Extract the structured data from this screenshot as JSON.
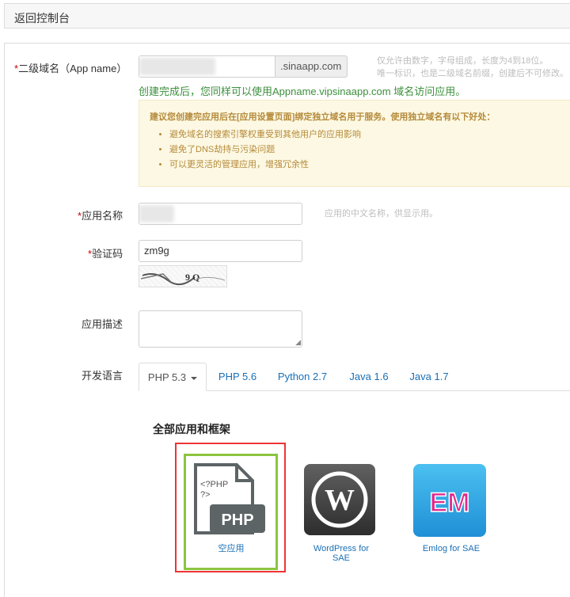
{
  "topbar": {
    "back_label": "返回控制台"
  },
  "form": {
    "domain": {
      "label": "二级域名（App name）",
      "suffix": ".sinaapp.com",
      "hint_line1": "仅允许由数字，字母组成，长度为4到18位。",
      "hint_line2": "唯一标识，也是二级域名前缀，创建后不可修改。",
      "note": "创建完成后，您同样可以使用Appname.vipsinaapp.com 域名访问应用。"
    },
    "notice": {
      "title": "建议您创建完应用后在[应用设置页面]绑定独立域名用于服务。使用独立域名有以下好处：",
      "items": [
        "避免域名的搜索引擎权重受到其他用户的应用影响",
        "避免了DNS劫持与污染问题",
        "可以更灵活的管理应用，增强冗余性"
      ]
    },
    "app_name": {
      "label": "应用名称",
      "hint": "应用的中文名称，供显示用。"
    },
    "captcha": {
      "label": "验证码",
      "value": "zm9g",
      "image_text": "9 Q"
    },
    "description": {
      "label": "应用描述"
    },
    "language": {
      "label": "开发语言",
      "tabs": [
        "PHP 5.3",
        "PHP 5.6",
        "Python 2.7",
        "Java 1.6",
        "Java 1.7"
      ]
    },
    "required_mark": "*"
  },
  "apps": {
    "title": "全部应用和框架",
    "items": [
      {
        "name": "空应用",
        "icon": "php-file-icon",
        "icon_text": "<?PHP\n?>",
        "badge": "PHP"
      },
      {
        "name_line1": "WordPress for",
        "name_line2": "SAE",
        "icon": "wordpress-icon",
        "logo": "W"
      },
      {
        "name": "Emlog for SAE",
        "icon": "emlog-icon",
        "logo": "EM"
      }
    ]
  },
  "colors": {
    "link": "#1a6fb5",
    "note_green": "#3c8f3c",
    "notice_bg": "#fcf8e3",
    "highlight_red": "#e33333",
    "highlight_green": "#8bc53f"
  }
}
